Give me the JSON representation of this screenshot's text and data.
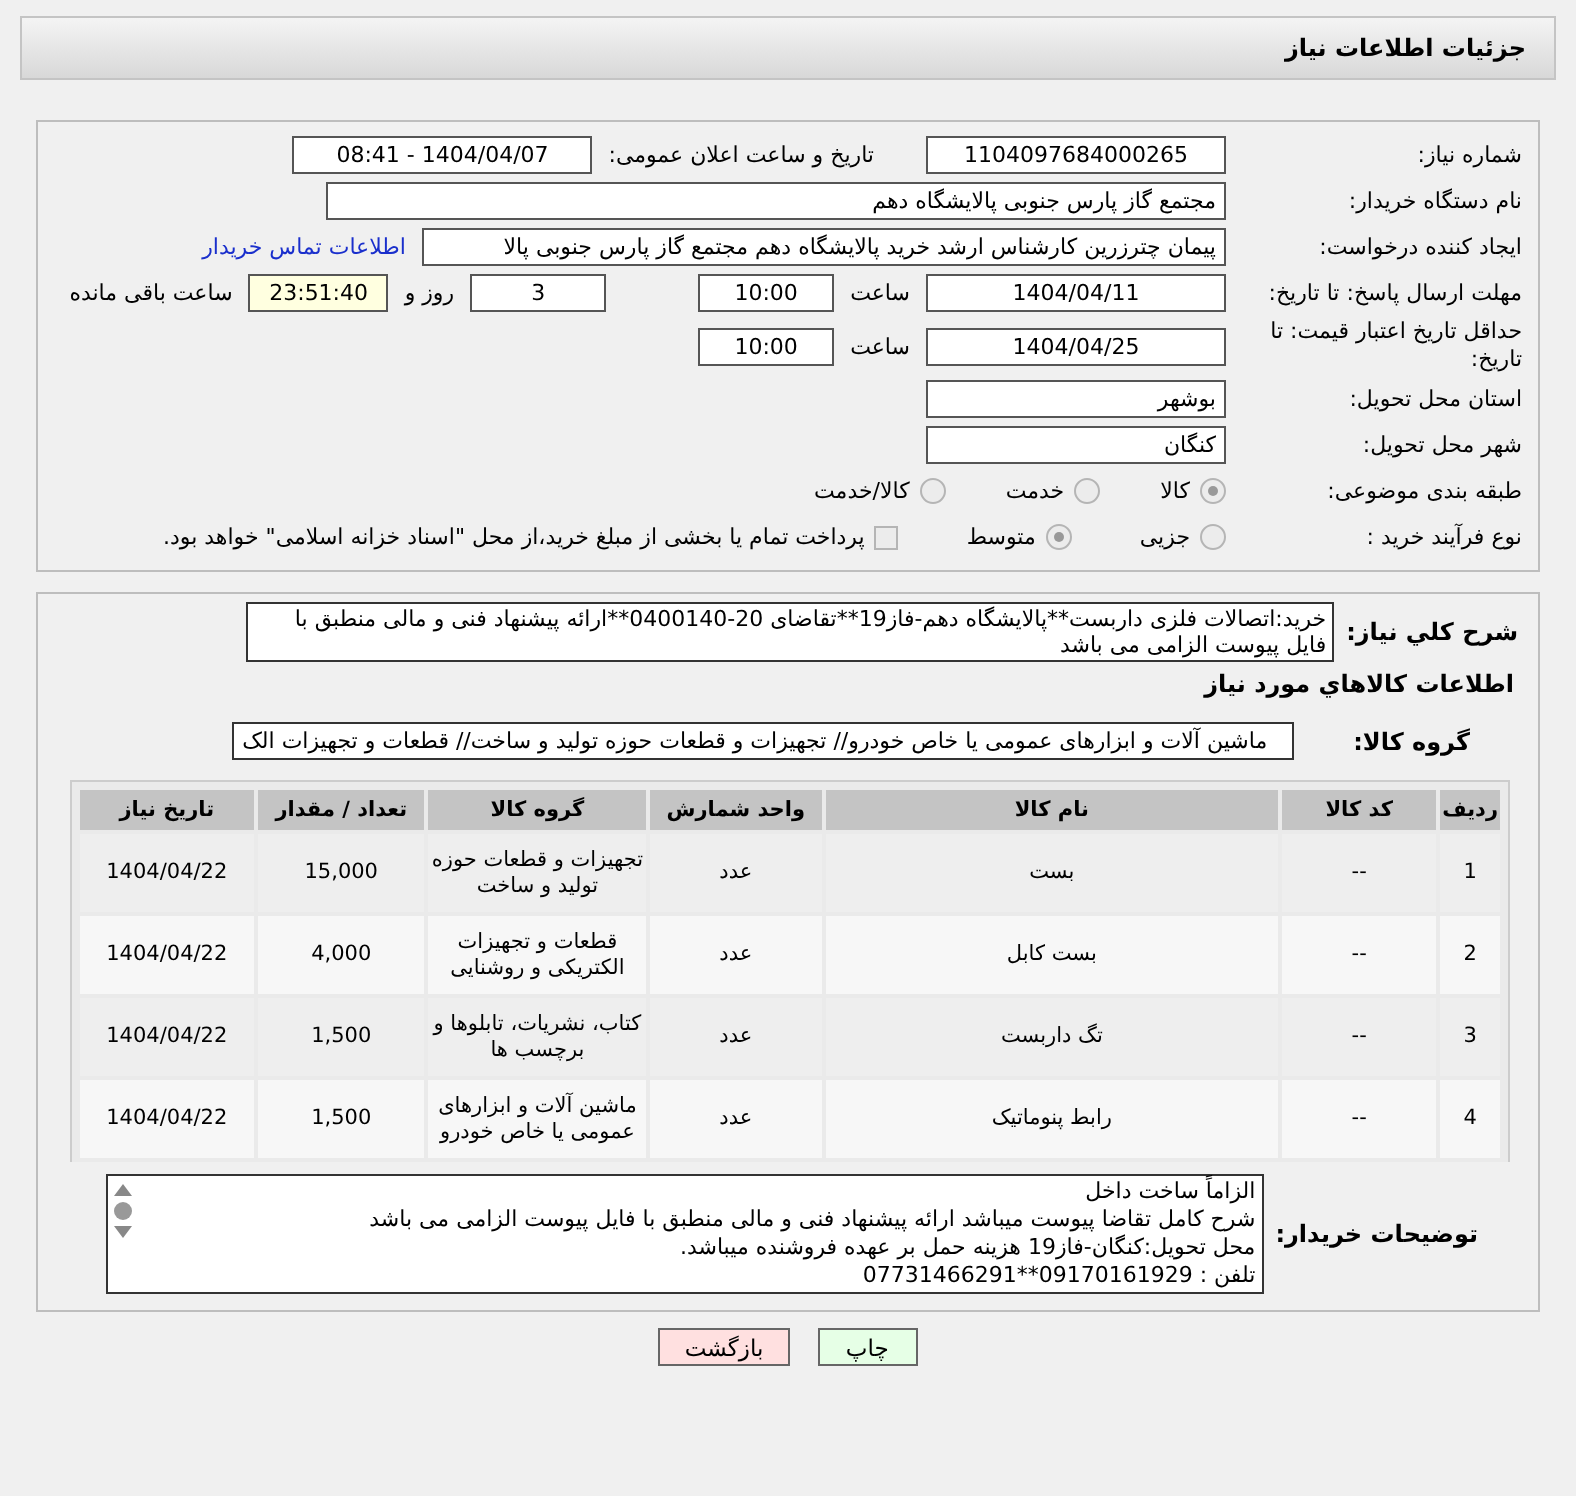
{
  "header": {
    "title": "جزئیات اطلاعات نیاز"
  },
  "form": {
    "need_number": {
      "label": "شماره نیاز:",
      "value": "1104097684000265"
    },
    "announce": {
      "label": "تاریخ و ساعت اعلان عمومی:",
      "value": "1404/04/07 - 08:41"
    },
    "buyer": {
      "label": "نام دستگاه خریدار:",
      "value": "مجتمع گاز پارس جنوبی  پالایشگاه دهم"
    },
    "creator": {
      "label": "ایجاد کننده درخواست:",
      "value": "پیمان چترزرین کارشناس ارشد خرید پالایشگاه دهم مجتمع گاز پارس جنوبی  پالا",
      "link": "اطلاعات تماس خریدار"
    },
    "deadline": {
      "label": "مهلت ارسال پاسخ: تا تاریخ:",
      "date": "1404/04/11",
      "time_label": "ساعت",
      "time": "10:00",
      "days": "3",
      "days_label": "روز و",
      "remaining": "23:51:40",
      "remaining_label": "ساعت باقی مانده"
    },
    "validity": {
      "label": "حداقل تاریخ اعتبار قیمت: تا تاریخ:",
      "date": "1404/04/25",
      "time_label": "ساعت",
      "time": "10:00"
    },
    "province": {
      "label": "استان محل تحویل:",
      "value": "بوشهر"
    },
    "city": {
      "label": "شهر محل تحویل:",
      "value": "کنگان"
    },
    "category": {
      "label": "طبقه بندی موضوعی:",
      "options": [
        {
          "label": "کالا",
          "selected": true
        },
        {
          "label": "خدمت",
          "selected": false
        },
        {
          "label": "کالا/خدمت",
          "selected": false
        }
      ]
    },
    "process": {
      "label": "نوع فرآیند خرید :",
      "options": [
        {
          "label": "جزیی",
          "selected": false
        },
        {
          "label": "متوسط",
          "selected": true
        }
      ],
      "payment": {
        "label": "پرداخت تمام یا بخشی از مبلغ خرید،از محل \"اسناد خزانه اسلامی\" خواهد بود.",
        "checked": false
      }
    }
  },
  "description": {
    "label": "شرح کلي نياز:",
    "text": "خرید:اتصالات فلزی داربست**پالایشگاه دهم-فاز19**تقاضای 20-0400140**ارائه پیشنهاد فنی و مالی منطبق با فایل پیوست الزامی می باشد"
  },
  "goods": {
    "title": "اطلاعات کالاهاي مورد نياز",
    "group_label": "گروه کالا:",
    "group_value": "ماشین آلات و ابزارهای عمومی یا خاص خودرو// تجهیزات و قطعات حوزه تولید و ساخت// قطعات و تجهیزات الک",
    "columns": [
      "ردیف",
      "کد کالا",
      "نام کالا",
      "واحد شمارش",
      "گروه کالا",
      "تعداد / مقدار",
      "تاریخ نیاز"
    ],
    "rows": [
      [
        "1",
        "--",
        "بست",
        "عدد",
        "تجهیزات و قطعات حوزه تولید و ساخت",
        "15,000",
        "1404/04/22"
      ],
      [
        "2",
        "--",
        "بست کابل",
        "عدد",
        "قطعات و تجهیزات الکتریکی و روشنایی",
        "4,000",
        "1404/04/22"
      ],
      [
        "3",
        "--",
        "تگ داربست",
        "عدد",
        "کتاب، نشریات، تابلوها و برچسب ها",
        "1,500",
        "1404/04/22"
      ],
      [
        "4",
        "--",
        "رابط پنوماتیک",
        "عدد",
        "ماشین آلات و ابزارهای عمومی یا خاص خودرو",
        "1,500",
        "1404/04/22"
      ]
    ]
  },
  "notes": {
    "label": "توضیحات خریدار:",
    "text": "الزاماً ساخت داخل\nشرح کامل تقاضا پیوست میباشد ارائه پیشنهاد فنی و مالی منطبق با فایل پیوست الزامی می باشد\nمحل تحویل:کنگان-فاز19 هزینه حمل بر عهده فروشنده میباشد.\nتلفن : 09170161929**07731466291"
  },
  "buttons": [
    {
      "label": "چاپ",
      "kind": "print"
    },
    {
      "label": "بازگشت",
      "kind": "back"
    }
  ]
}
